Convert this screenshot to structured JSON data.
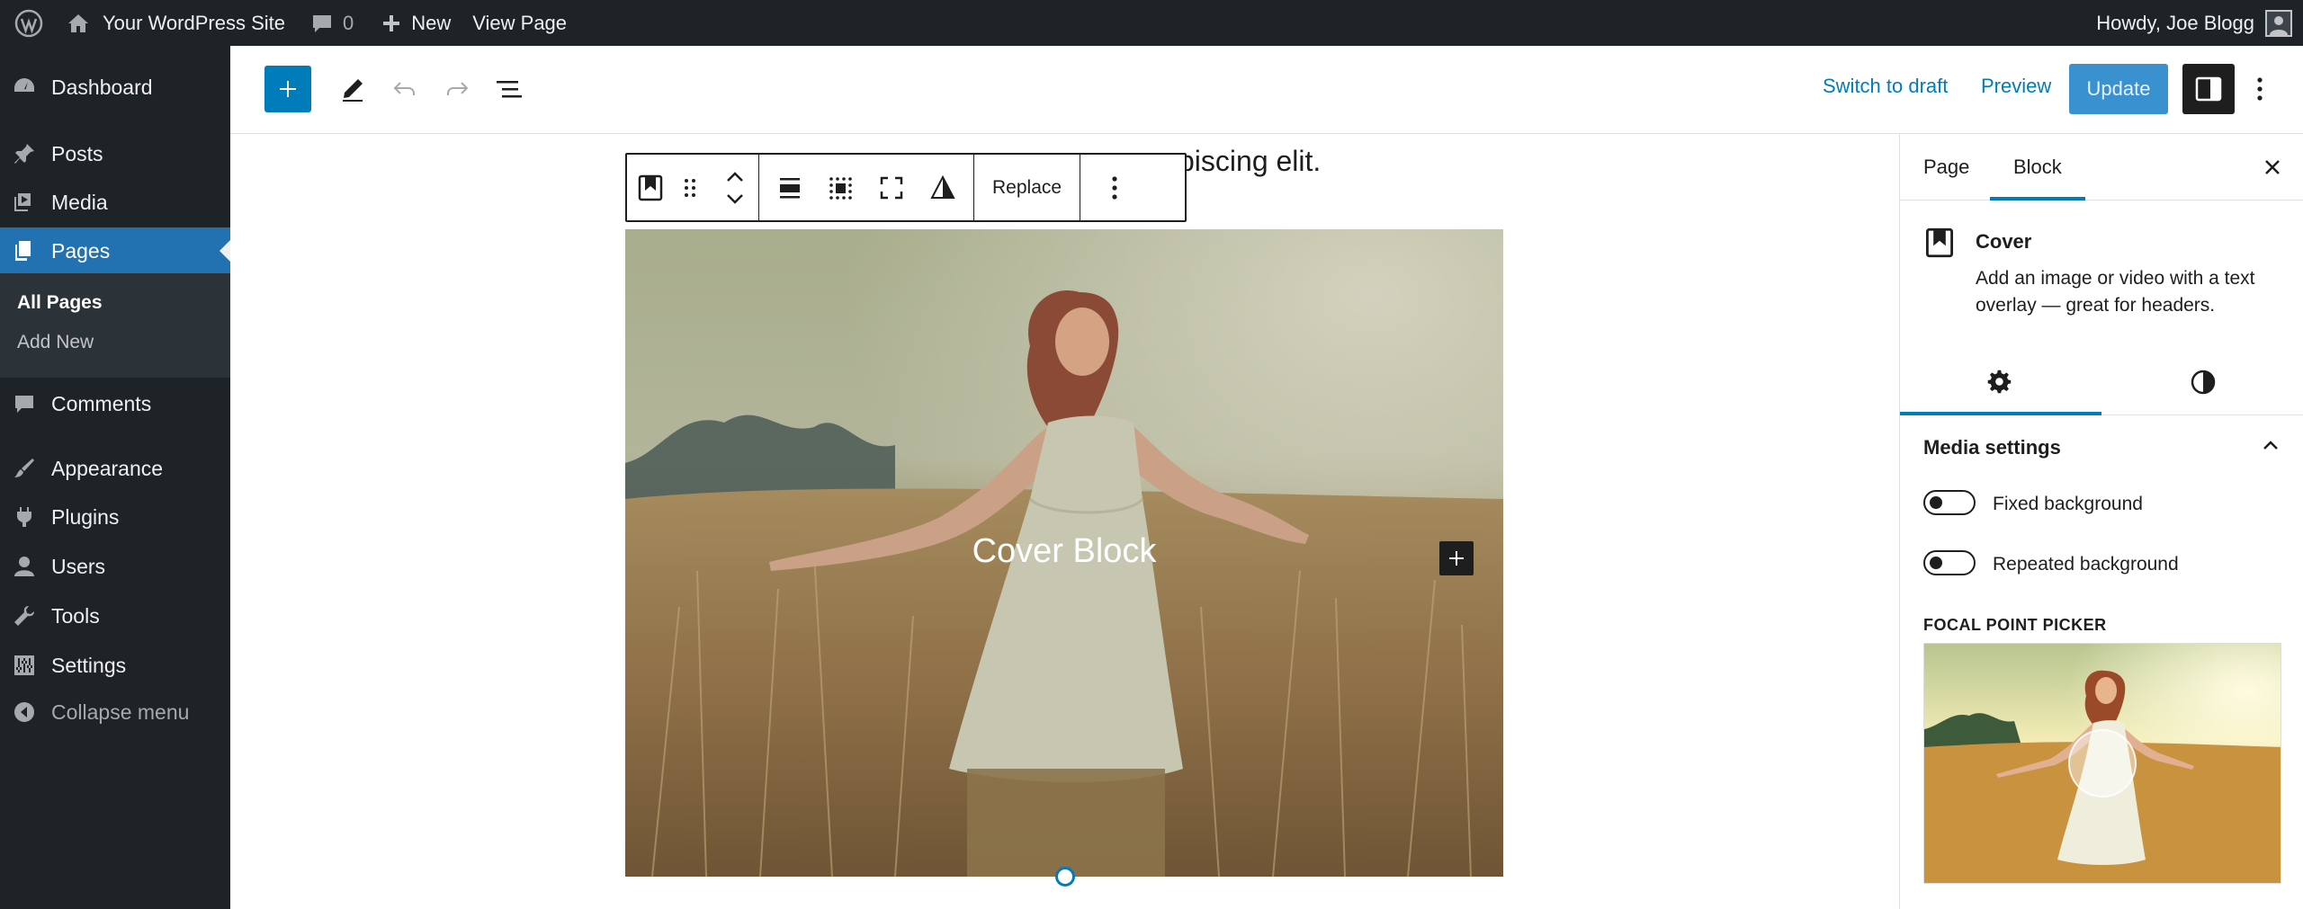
{
  "admin_bar": {
    "site_name": "Your WordPress Site",
    "comment_count": "0",
    "new_label": "New",
    "view_page_label": "View Page",
    "greeting": "Howdy, Joe Blogg"
  },
  "admin_menu": {
    "items": [
      {
        "label": "Dashboard",
        "icon": "dashboard-icon"
      },
      {
        "label": "Posts",
        "icon": "pin-icon"
      },
      {
        "label": "Media",
        "icon": "media-icon"
      },
      {
        "label": "Pages",
        "icon": "pages-icon"
      },
      {
        "label": "Comments",
        "icon": "comment-icon"
      },
      {
        "label": "Appearance",
        "icon": "brush-icon"
      },
      {
        "label": "Plugins",
        "icon": "plugin-icon"
      },
      {
        "label": "Users",
        "icon": "user-icon"
      },
      {
        "label": "Tools",
        "icon": "wrench-icon"
      },
      {
        "label": "Settings",
        "icon": "sliders-icon"
      }
    ],
    "current": "Pages",
    "submenu": [
      {
        "label": "All Pages"
      },
      {
        "label": "Add New"
      }
    ],
    "collapse_label": "Collapse menu",
    "accent_color": "#2271b1"
  },
  "editor_header": {
    "switch_to_draft": "Switch to draft",
    "preview": "Preview",
    "update": "Update"
  },
  "canvas": {
    "paragraph_visible_text": "piscing elit.",
    "block_toolbar": {
      "replace_label": "Replace"
    },
    "cover_block": {
      "title": "Cover Block"
    }
  },
  "settings_sidebar": {
    "tabs": [
      {
        "label": "Page"
      },
      {
        "label": "Block"
      }
    ],
    "active_tab": "Block",
    "block": {
      "name": "Cover",
      "description": "Add an image or video with a text overlay — great for headers."
    },
    "media_settings": {
      "title": "Media settings",
      "fixed_background": "Fixed background",
      "repeated_background": "Repeated background",
      "fixed_background_on": false,
      "repeated_background_on": false
    },
    "focal_point_label": "FOCAL POINT PICKER"
  }
}
